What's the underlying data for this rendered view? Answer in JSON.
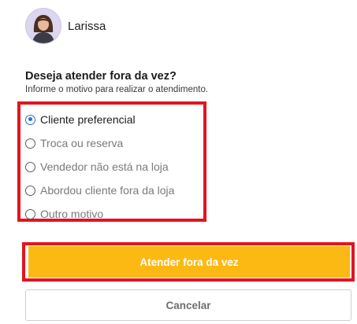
{
  "user": {
    "name": "Larissa"
  },
  "question": {
    "title": "Deseja atender fora da vez?",
    "subtitle": "Informe o motivo para realizar o atendimento."
  },
  "options": [
    {
      "label": "Cliente preferencial",
      "selected": true
    },
    {
      "label": "Troca ou reserva",
      "selected": false
    },
    {
      "label": "Vendedor não está na loja",
      "selected": false
    },
    {
      "label": "Abordou cliente fora da loja",
      "selected": false
    },
    {
      "label": "Outro motivo",
      "selected": false
    }
  ],
  "actions": {
    "primary_label": "Atender fora da vez",
    "secondary_label": "Cancelar"
  },
  "colors": {
    "accent": "#fdb913",
    "highlight": "#e3141f",
    "radio_selected": "#2a6fd6"
  }
}
